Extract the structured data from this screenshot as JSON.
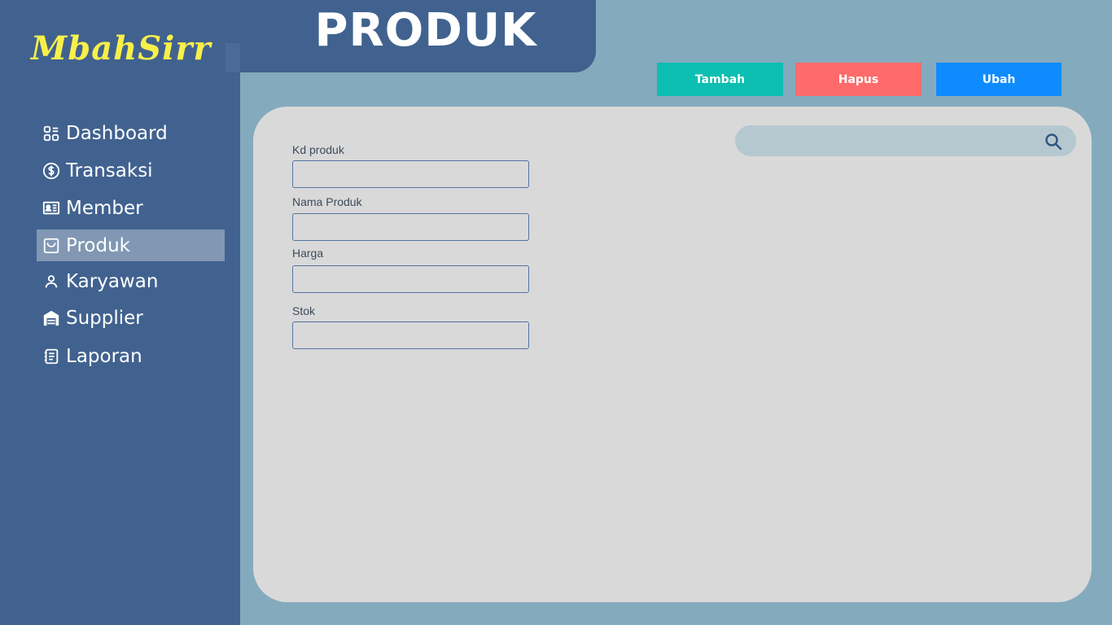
{
  "brand": {
    "logo": "MbahSirr"
  },
  "page": {
    "title": "PRODUK"
  },
  "sidebar": {
    "items": [
      {
        "label": "Dashboard",
        "icon": "dashboard-icon"
      },
      {
        "label": "Transaksi",
        "icon": "dollar-circle-icon"
      },
      {
        "label": "Member",
        "icon": "member-card-icon"
      },
      {
        "label": "Produk",
        "icon": "shopping-bag-icon",
        "active": true
      },
      {
        "label": "Karyawan",
        "icon": "person-icon"
      },
      {
        "label": "Supplier",
        "icon": "warehouse-icon"
      },
      {
        "label": "Laporan",
        "icon": "report-icon"
      }
    ]
  },
  "actions": {
    "tambah": "Tambah",
    "hapus": "Hapus",
    "ubah": "Ubah"
  },
  "search": {
    "placeholder": "",
    "value": ""
  },
  "form": {
    "kd_produk_label": "Kd produk",
    "kd_produk_value": "",
    "nama_produk_label": "Nama Produk",
    "nama_produk_value": "",
    "harga_label": "Harga",
    "harga_value": "",
    "stok_label": "Stok",
    "stok_value": ""
  },
  "colors": {
    "sidebar": "#41628f",
    "background": "#84aabd",
    "panel": "#d9d9d9",
    "logo": "#f7f04a",
    "tambah": "#0cbfb2",
    "hapus": "#ff6b6b",
    "ubah": "#0d8bff",
    "active_item": "#8197b3"
  }
}
